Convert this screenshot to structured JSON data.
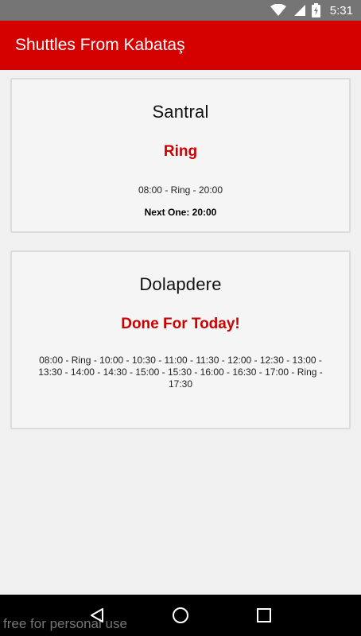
{
  "status_bar": {
    "time": "5:31",
    "icons": [
      "wifi-icon",
      "signal-icon",
      "battery-charging-icon"
    ]
  },
  "app_bar": {
    "title": "Shuttles From Kabataş"
  },
  "cards": [
    {
      "title": "Santral",
      "status": "Ring",
      "schedule": "08:00 - Ring - 20:00",
      "next": "Next One: 20:00"
    },
    {
      "title": "Dolapdere",
      "status": "Done For Today!",
      "schedule": "08:00 - Ring - 10:00 - 10:30 - 11:00 - 11:30 - 12:00 - 12:30 - 13:00 - 13:30 - 14:00 - 14:30 - 15:00 - 15:30 - 16:00 - 16:30 - 17:00 - Ring - 17:30"
    }
  ],
  "nav_bar": {
    "icons": [
      "back-icon",
      "home-icon",
      "recents-icon"
    ]
  },
  "watermark": "free for personal use",
  "colors": {
    "app_bar": "#d50000",
    "accent_text": "#cc0000",
    "status_bar": "#757575"
  }
}
